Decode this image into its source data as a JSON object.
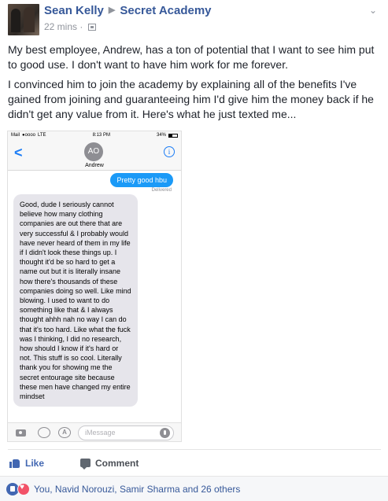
{
  "header": {
    "author": "Sean Kelly",
    "group": "Secret Academy",
    "time": "22 mins",
    "separator": "·",
    "arrow": "▶",
    "chevron": "⌄"
  },
  "post": {
    "paragraphs": [
      "My best employee, Andrew, has a ton of potential that I want to see him put to good use. I don't want to have him work for me forever.",
      "I convinced him to join the academy by explaining all of the benefits I've gained from joining and guaranteeing him I'd give him the money back if he didn't get any value from it. Here's what he just texted me..."
    ]
  },
  "screenshot": {
    "carrier": "Mail",
    "signal": "●oooo",
    "network": "LTE",
    "time": "8:13 PM",
    "battery": "34%",
    "back": "<",
    "contact_initials": "AO",
    "contact_name": "Andrew",
    "info": "i",
    "outgoing": "Pretty good hbu",
    "delivered": "Delivered",
    "incoming": "Good, dude I seriously cannot believe how many clothing companies are out there that are very successful & I probably would have never heard of them in my life if I didn't look these things up. I thought it'd be so hard to get a name out but it is literally insane how there's thousands of these companies doing so well. Like mind blowing. I used to want to do something like that & I always thought ahhh nah no way I can do that it's too hard. Like what the fuck was I thinking, I did no research, how should I know if it's hard or not. This stuff is so cool. Literally thank you for showing me the secret entourage site because these men have changed my entire mindset",
    "apps_glyph": "A",
    "placeholder": "iMessage"
  },
  "actions": {
    "like": "Like",
    "comment": "Comment"
  },
  "reactions": {
    "names": "You, Navid Norouzi, Samir Sharma and 26 others"
  }
}
